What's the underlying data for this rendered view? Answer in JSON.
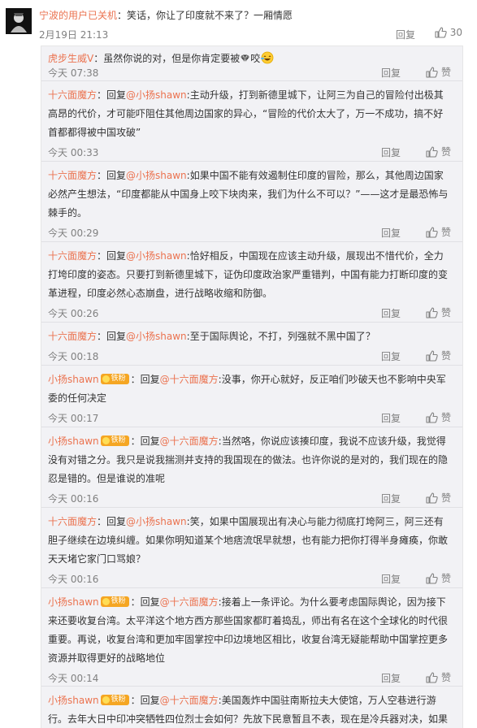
{
  "main": {
    "user": "宁波的用户已关机",
    "sep": "：",
    "text": "笑话，你让了印度就不来了？一厢情愿",
    "time": "2月19日 21:13",
    "reply_label": "回复",
    "likes": "30"
  },
  "replies": [
    {
      "user": "虎步生威V",
      "badge": "",
      "pre": "",
      "mention": "",
      "sep": "：",
      "text": "虽然你说的对，但是你肯定要被",
      "tail": "咬",
      "emoji": true,
      "time": "今天 07:38",
      "reply_label": "回复",
      "like_label": "赞"
    },
    {
      "user": "十六面魔方",
      "badge": "",
      "pre": "：回复",
      "mention": "@小扬shawn",
      "sep": ":",
      "text": "主动升级，打到新德里城下，让阿三为自己的冒险付出极其高昂的代价，才可能吓阻住其他周边国家的异心，“冒险的代价太大了，万一不成功，搞不好首都都得被中国攻破”",
      "tail": "",
      "emoji": false,
      "time": "今天 00:33",
      "reply_label": "回复",
      "like_label": "赞"
    },
    {
      "user": "十六面魔方",
      "badge": "",
      "pre": "：回复",
      "mention": "@小扬shawn",
      "sep": ":",
      "text": "如果中国不能有效遏制住印度的冒险，那么，其他周边国家必然产生想法，“印度都能从中国身上咬下块肉来，我们为什么不可以？”——这才是最恐怖与棘手的。",
      "tail": "",
      "emoji": false,
      "time": "今天 00:29",
      "reply_label": "回复",
      "like_label": "赞"
    },
    {
      "user": "十六面魔方",
      "badge": "",
      "pre": "：回复",
      "mention": "@小扬shawn",
      "sep": ":",
      "text": "恰好相反，中国现在应该主动升级，展现出不惜代价，全力打垮印度的姿态。只要打到新德里城下，证伪印度政治家严重错判，中国有能力打断印度的变革进程，印度必然心态崩盘，进行战略收缩和防御。",
      "tail": "",
      "emoji": false,
      "time": "今天 00:26",
      "reply_label": "回复",
      "like_label": "赞"
    },
    {
      "user": "十六面魔方",
      "badge": "",
      "pre": "：回复",
      "mention": "@小扬shawn",
      "sep": ":",
      "text": "至于国际舆论，不打，列强就不黑中国了？",
      "tail": "",
      "emoji": false,
      "time": "今天 00:18",
      "reply_label": "回复",
      "like_label": "赞"
    },
    {
      "user": "小扬shawn",
      "badge": "铁粉",
      "pre": "：回复",
      "mention": "@十六面魔方",
      "sep": ":",
      "text": "没事，你开心就好，反正咱们吵破天也不影响中央军委的任何决定",
      "tail": "",
      "emoji": false,
      "time": "今天 00:17",
      "reply_label": "回复",
      "like_label": "赞"
    },
    {
      "user": "小扬shawn",
      "badge": "铁粉",
      "pre": "：回复",
      "mention": "@十六面魔方",
      "sep": ":",
      "text": "当然咯，你说应该揍印度，我说不应该升级，我觉得没有对错之分。我只是说我揣测并支持的我国现在的做法。也许你说的是对的，我们现在的隐忍是错的。但是谁说的准呢",
      "tail": "",
      "emoji": false,
      "time": "今天 00:16",
      "reply_label": "回复",
      "like_label": "赞"
    },
    {
      "user": "十六面魔方",
      "badge": "",
      "pre": "：回复",
      "mention": "@小扬shawn",
      "sep": ":",
      "text": "笑，如果中国展现出有决心与能力彻底打垮阿三，阿三还有胆子继续在边境纠缠。如果你明知道某个地痞流氓早就想，也有能力把你打得半身瘫痪，你敢天天堵它家门口骂娘？",
      "tail": "",
      "emoji": false,
      "time": "今天 00:16",
      "reply_label": "回复",
      "like_label": "赞"
    },
    {
      "user": "小扬shawn",
      "badge": "铁粉",
      "pre": "：回复",
      "mention": "@十六面魔方",
      "sep": ":",
      "text": "接着上一条评论。为什么要考虑国际舆论，因为接下来还要收复台湾。太平洋这个地方西方那些国家都盯着捣乱，师出有名在这个全球化的时代很重要。再说，收复台湾和更加牢固掌控中印边境地区相比，收复台湾无疑能帮助中国掌控更多资源并取得更好的战略地位",
      "tail": "",
      "emoji": false,
      "time": "今天 00:14",
      "reply_label": "回复",
      "like_label": "赞"
    },
    {
      "user": "小扬shawn",
      "badge": "铁粉",
      "pre": "：回复",
      "mention": "@十六面魔方",
      "sep": ":",
      "text": "美国轰炸中国驻南斯拉夫大使馆，万人空巷进行游行。去年大日中印冲突牺牲四位烈士会如何？先放下民意暂且不表，现在是冷兵器对决，如果",
      "tail": "",
      "emoji": false,
      "time": "",
      "reply_label": "",
      "like_label": ""
    }
  ],
  "colors": {
    "link": "#eb7350",
    "text": "#333333",
    "meta": "#808080",
    "panel": "#f2f2f5",
    "badge": "#f5a623"
  },
  "icons": {
    "like": "thumb-up-icon",
    "avatar": "avatar-image",
    "badge": "fan-badge-icon",
    "gem": "diamond-icon",
    "emoji": "laughing-emoji-icon"
  }
}
